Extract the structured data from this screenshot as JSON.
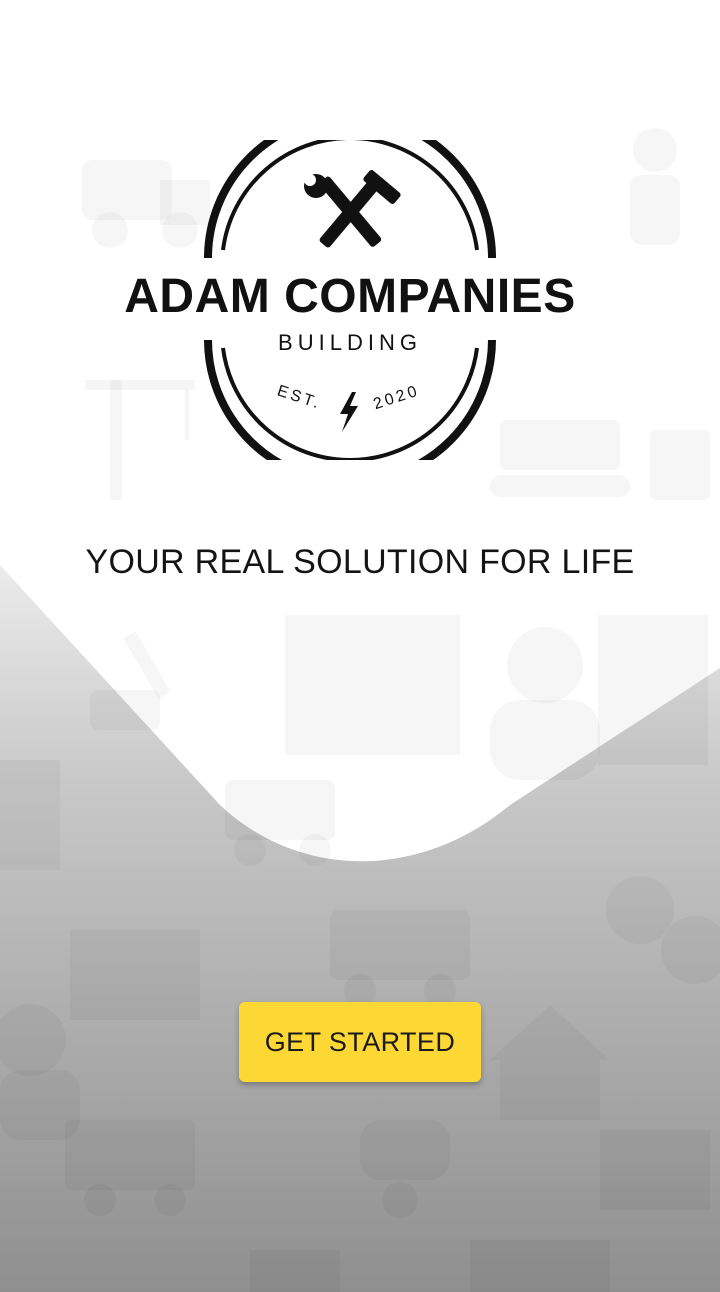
{
  "brand": {
    "name": "ADAM COMPANIES",
    "sub": "BUILDING",
    "est_left": "EST.",
    "est_right": "2020"
  },
  "tagline": "YOUR REAL SOLUTION FOR LIFE",
  "cta": {
    "label": "GET STARTED"
  },
  "colors": {
    "accent": "#fdd835",
    "text": "#141414",
    "background_top": "#ffffff",
    "background_bottom": "#8f8f8f"
  },
  "icons": {
    "logo_emblem": "crossed-hammer-wrench-icon",
    "logo_bolt": "lightning-bolt-icon",
    "background_pattern": "construction-tools-pattern"
  }
}
